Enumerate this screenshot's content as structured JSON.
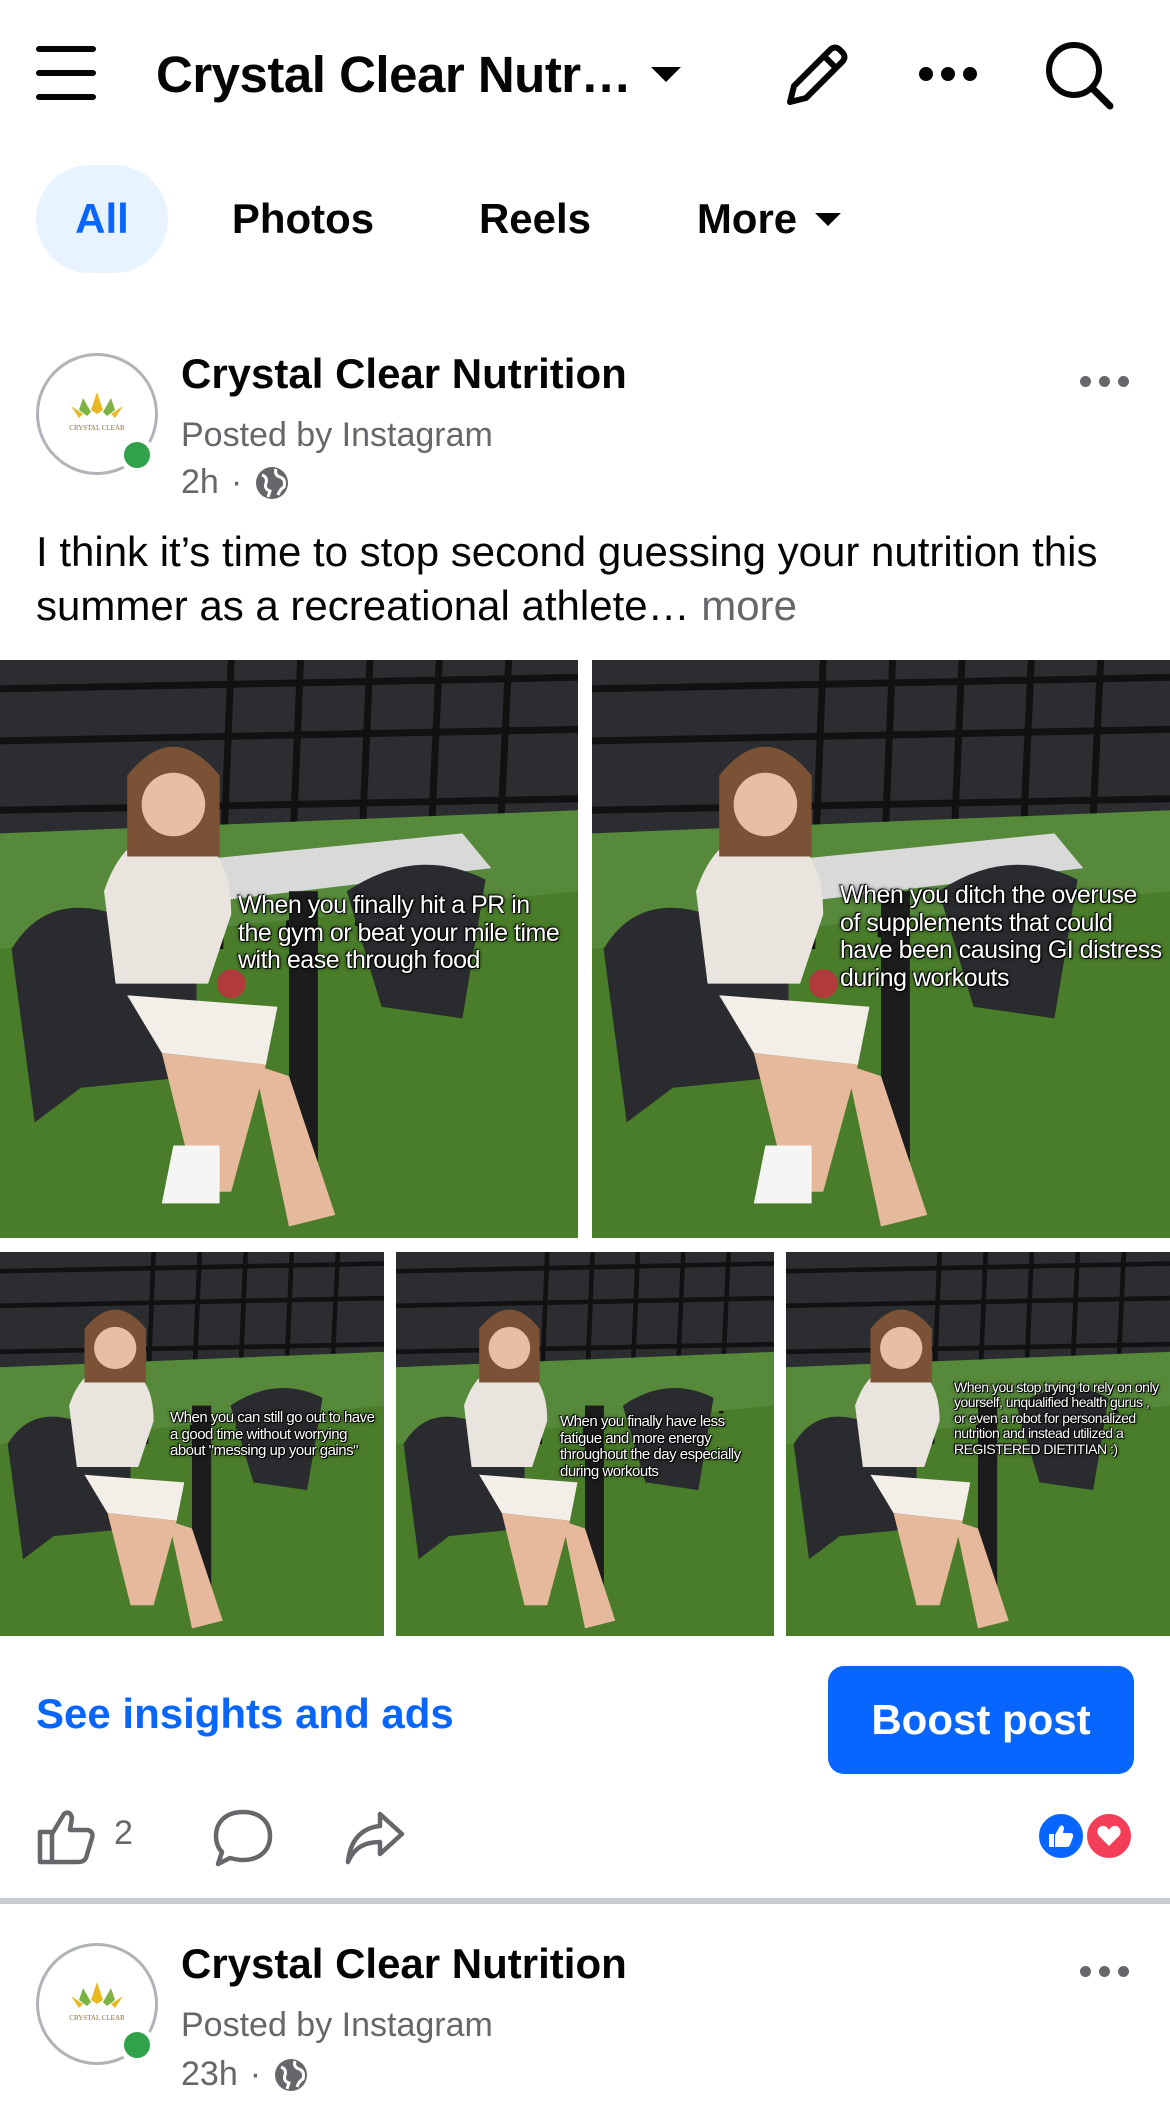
{
  "header": {
    "title": "Crystal Clear Nutr…",
    "menu_icon": "hamburger-menu-icon",
    "edit_icon": "pencil-icon",
    "more_icon": "more-horizontal-icon",
    "search_icon": "search-icon"
  },
  "tabs": [
    {
      "label": "All",
      "active": true
    },
    {
      "label": "Photos",
      "active": false
    },
    {
      "label": "Reels",
      "active": false
    },
    {
      "label": "More",
      "active": false
    }
  ],
  "posts": [
    {
      "author": "Crystal Clear Nutrition",
      "posted_by": "Posted by Instagram",
      "time": "2h",
      "dot": "·",
      "caption": "I think it’s time to stop second guessing your nutrition this summer as a recreational athlete…",
      "more_label": "more",
      "photos": [
        {
          "overlay": "When you finally hit a PR in the gym or beat your mile time with ease through food"
        },
        {
          "overlay": "When you ditch the overuse of supplements that could have been causing GI distress during workouts"
        },
        {
          "overlay": "When you can still go out to have a good time without worrying about \"messing up your gains\""
        },
        {
          "overlay": "When you finally have less fatigue and more energy throughout the day especially during workouts"
        },
        {
          "overlay": "When you stop trying to rely on only yourself, unqualified health gurus , or even a robot for personalized nutrition and instead utilized a REGISTERED DIETITIAN :)"
        }
      ],
      "insights_label": "See insights and ads",
      "boost_label": "Boost post",
      "like_count": "2",
      "reactions": [
        "like-reaction-icon",
        "love-reaction-icon"
      ]
    },
    {
      "author": "Crystal Clear Nutrition",
      "posted_by": "Posted by Instagram",
      "time": "23h",
      "dot": "·"
    }
  ],
  "brand": {
    "logo_text": "CRYSTAL CLEAR",
    "accent": "#0866ff",
    "tab_active_bg": "#e7f3ff",
    "online": "#31a24c"
  }
}
